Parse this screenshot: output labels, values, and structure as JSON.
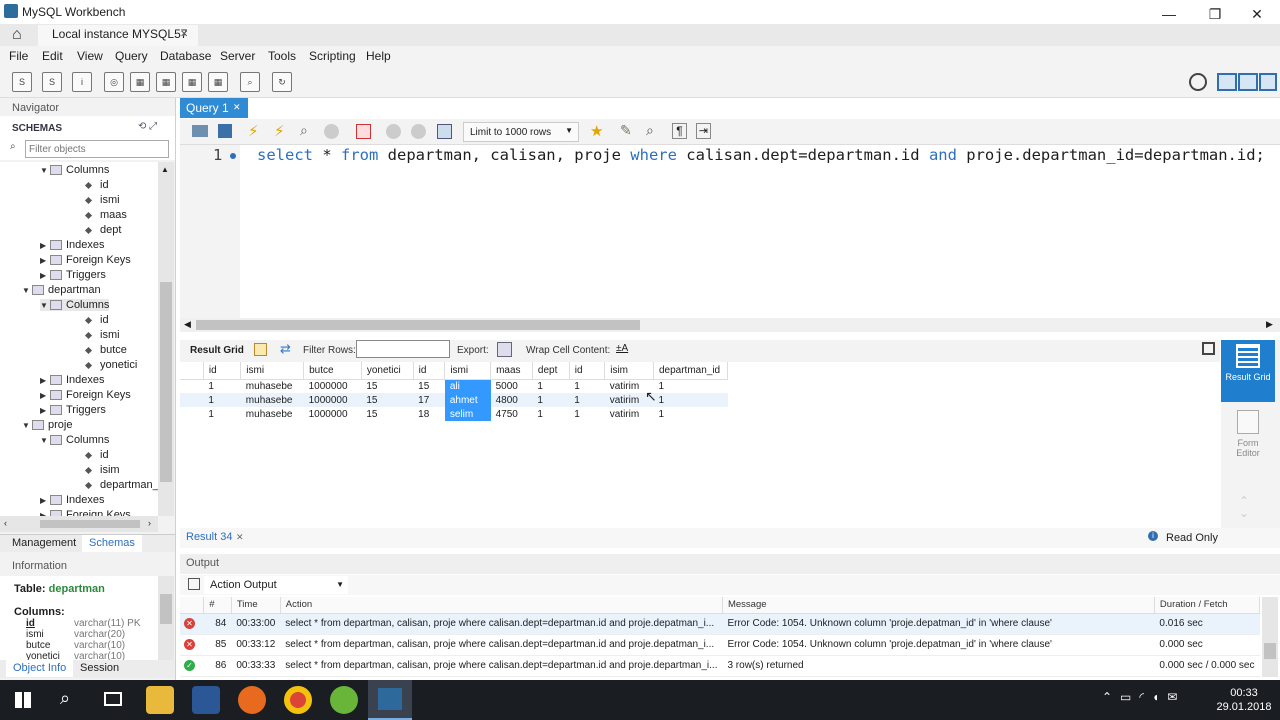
{
  "window": {
    "title": "MySQL Workbench",
    "minimize": "—",
    "restore": "❐",
    "close": "✕"
  },
  "tab": {
    "label": "Local instance MYSQL57",
    "close": "✕"
  },
  "menu": [
    "File",
    "Edit",
    "View",
    "Query",
    "Database",
    "Server",
    "Tools",
    "Scripting",
    "Help"
  ],
  "navigator": {
    "title": "Navigator",
    "schemas": "SCHEMAS",
    "filter_placeholder": "Filter objects",
    "tree": [
      {
        "indent": 2,
        "arrow": "▼",
        "icon": "folder",
        "label": "Columns"
      },
      {
        "indent": 4,
        "arrow": "",
        "icon": "dot",
        "label": "id"
      },
      {
        "indent": 4,
        "arrow": "",
        "icon": "dot",
        "label": "ismi"
      },
      {
        "indent": 4,
        "arrow": "",
        "icon": "dot",
        "label": "maas"
      },
      {
        "indent": 4,
        "arrow": "",
        "icon": "dot",
        "label": "dept"
      },
      {
        "indent": 2,
        "arrow": "▶",
        "icon": "folder",
        "label": "Indexes"
      },
      {
        "indent": 2,
        "arrow": "▶",
        "icon": "folder",
        "label": "Foreign Keys"
      },
      {
        "indent": 2,
        "arrow": "▶",
        "icon": "folder",
        "label": "Triggers"
      },
      {
        "indent": 1,
        "arrow": "▼",
        "icon": "table",
        "label": "departman"
      },
      {
        "indent": 2,
        "arrow": "▼",
        "icon": "folder",
        "label": "Columns"
      },
      {
        "indent": 4,
        "arrow": "",
        "icon": "dot",
        "label": "id"
      },
      {
        "indent": 4,
        "arrow": "",
        "icon": "dot",
        "label": "ismi"
      },
      {
        "indent": 4,
        "arrow": "",
        "icon": "dot",
        "label": "butce"
      },
      {
        "indent": 4,
        "arrow": "",
        "icon": "dot",
        "label": "yonetici"
      },
      {
        "indent": 2,
        "arrow": "▶",
        "icon": "folder",
        "label": "Indexes"
      },
      {
        "indent": 2,
        "arrow": "▶",
        "icon": "folder",
        "label": "Foreign Keys"
      },
      {
        "indent": 2,
        "arrow": "▶",
        "icon": "folder",
        "label": "Triggers"
      },
      {
        "indent": 1,
        "arrow": "▼",
        "icon": "table",
        "label": "proje"
      },
      {
        "indent": 2,
        "arrow": "▼",
        "icon": "folder",
        "label": "Columns"
      },
      {
        "indent": 4,
        "arrow": "",
        "icon": "dot",
        "label": "id"
      },
      {
        "indent": 4,
        "arrow": "",
        "icon": "dot",
        "label": "isim"
      },
      {
        "indent": 4,
        "arrow": "",
        "icon": "dot",
        "label": "departman_id"
      },
      {
        "indent": 2,
        "arrow": "▶",
        "icon": "folder",
        "label": "Indexes"
      },
      {
        "indent": 2,
        "arrow": "▶",
        "icon": "folder",
        "label": "Foreign Keys"
      }
    ],
    "tabs": [
      "Management",
      "Schemas"
    ]
  },
  "information": {
    "title": "Information",
    "table_label": "Table:",
    "table_name": "departman",
    "columns_label": "Columns:",
    "columns": [
      {
        "name": "id",
        "type": "varchar(11) PK"
      },
      {
        "name": "ismi",
        "type": "varchar(20)"
      },
      {
        "name": "butce",
        "type": "varchar(10)"
      },
      {
        "name": "yonetici",
        "type": "varchar(10)"
      }
    ],
    "tabs": [
      "Object Info",
      "Session"
    ]
  },
  "query": {
    "tab": "Query 1",
    "line_number": "1",
    "limit": "Limit to 1000 rows",
    "code": [
      {
        "t": "select",
        "k": true
      },
      {
        "t": " * ",
        "k": false
      },
      {
        "t": "from",
        "k": true
      },
      {
        "t": " departman, calisan, proje ",
        "k": false
      },
      {
        "t": "where",
        "k": true
      },
      {
        "t": " calisan.dept=departman.id ",
        "k": false
      },
      {
        "t": "and",
        "k": true
      },
      {
        "t": " proje.departman_id=departman.id;",
        "k": false
      }
    ]
  },
  "resultgrid": {
    "label": "Result Grid",
    "filter": "Filter Rows:",
    "export": "Export:",
    "wrap": "Wrap Cell Content:",
    "columns": [
      "id",
      "ismi",
      "butce",
      "yonetici",
      "id",
      "ismi",
      "maas",
      "dept",
      "id",
      "isim",
      "departman_id"
    ],
    "rows": [
      [
        "1",
        "muhasebe",
        "1000000",
        "15",
        "15",
        "ali",
        "5000",
        "1",
        "1",
        "vatirim",
        "1"
      ],
      [
        "1",
        "muhasebe",
        "1000000",
        "15",
        "17",
        "ahmet",
        "4800",
        "1",
        "1",
        "vatirim",
        "1"
      ],
      [
        "1",
        "muhasebe",
        "1000000",
        "15",
        "18",
        "selim",
        "4750",
        "1",
        "1",
        "vatirim",
        "1"
      ]
    ]
  },
  "sidebuttons": {
    "result_grid": "Result Grid",
    "form_editor": "Form Editor"
  },
  "resultbar": {
    "tab": "Result 34",
    "readonly": "Read Only"
  },
  "output": {
    "title": "Output",
    "mode": "Action Output",
    "headers": [
      "#",
      "Time",
      "Action",
      "Message",
      "Duration / Fetch"
    ],
    "rows": [
      {
        "status": "error",
        "num": "84",
        "time": "00:33:00",
        "action": "select * from departman, calisan, proje where calisan.dept=departman.id and proje.depatman_i...",
        "message": "Error Code: 1054. Unknown column 'proje.depatman_id' in 'where clause'",
        "duration": "0.016 sec"
      },
      {
        "status": "error",
        "num": "85",
        "time": "00:33:12",
        "action": "select * from departman, calisan, proje where calisan.dept=departman.id and proje.depatman_i...",
        "message": "Error Code: 1054. Unknown column 'proje.depatman_id' in 'where clause'",
        "duration": "0.000 sec"
      },
      {
        "status": "ok",
        "num": "86",
        "time": "00:33:33",
        "action": "select * from departman, calisan, proje where calisan.dept=departman.id and proje.departman_i...",
        "message": "3 row(s) returned",
        "duration": "0.000 sec / 0.000 sec"
      }
    ]
  },
  "taskbar": {
    "time": "00:33",
    "date": "29.01.2018"
  },
  "colors": {
    "accent": "#2f8bd3",
    "keyword": "#2c6fbf",
    "selected": "#3399ff",
    "taskbar": "#1a1d22",
    "error": "#d9413b",
    "ok": "#2eae4a"
  }
}
